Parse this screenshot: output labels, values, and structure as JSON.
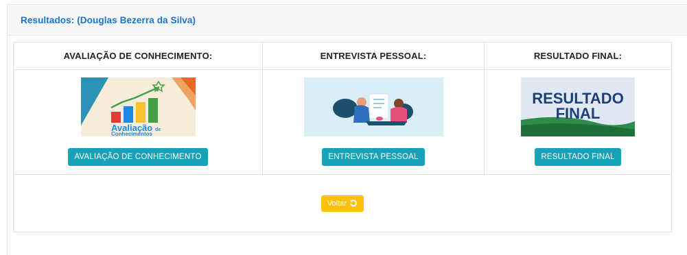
{
  "card": {
    "title": "Resultados: (Douglas Bezerra da Silva)"
  },
  "columns": [
    {
      "header": "AVALIAÇÃO DE CONHECIMENTO:",
      "image_text": [
        "Avaliação",
        "de",
        "Conhecimentos"
      ],
      "button": "AVALIAÇÃO DE CONHECIMENTO"
    },
    {
      "header": "ENTREVISTA PESSOAL:",
      "button": "ENTREVISTA PESSOAL"
    },
    {
      "header": "RESULTADO FINAL:",
      "image_text": [
        "RESULTADO",
        "FINAL"
      ],
      "button": "RESULTADO FINAL"
    }
  ],
  "back_button": {
    "label": "Voltar",
    "icon": "undo-icon"
  },
  "colors": {
    "title": "#1d72c9",
    "info_button": "#17a2b8",
    "warning_button": "#ffc107"
  }
}
